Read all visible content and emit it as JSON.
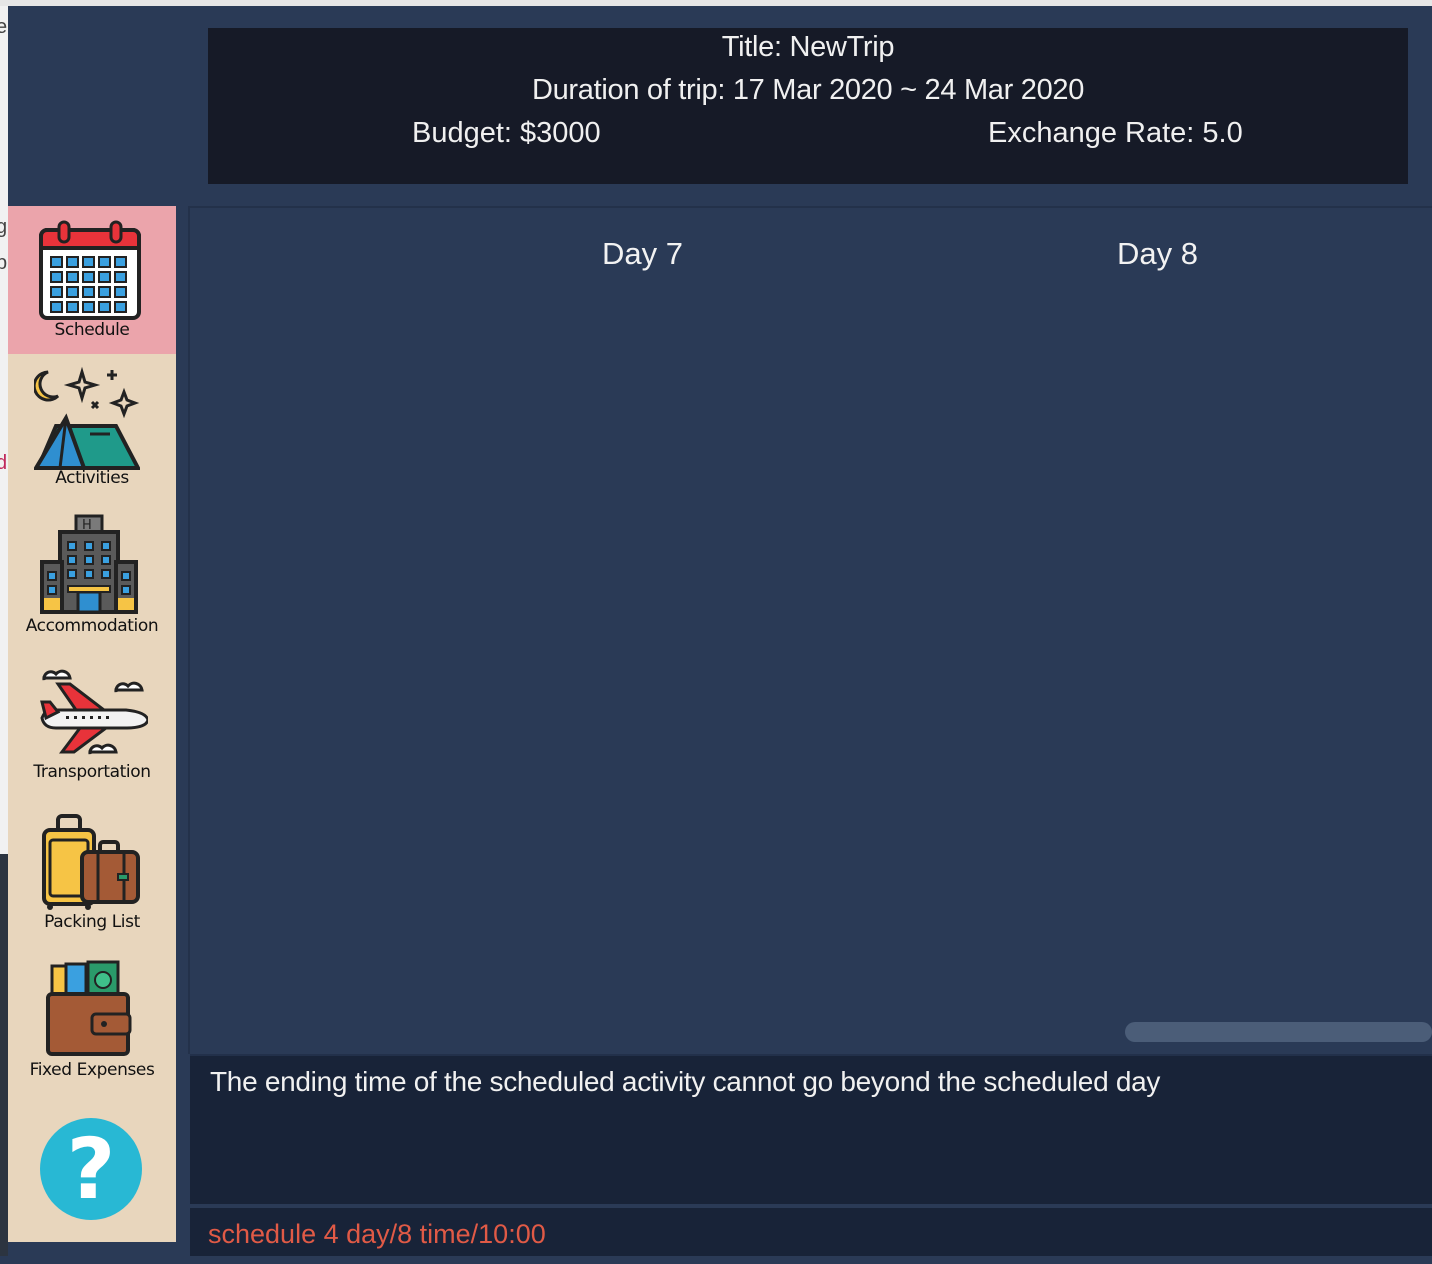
{
  "header": {
    "title": "Title: NewTrip",
    "duration": "Duration of trip: 17 Mar 2020 ~ 24 Mar 2020",
    "budget": "Budget: $3000",
    "exchange_rate": "Exchange Rate: 5.0"
  },
  "sidebar": {
    "items": [
      {
        "label": "Schedule",
        "icon": "calendar-icon",
        "active": true
      },
      {
        "label": "Activities",
        "icon": "tent-icon",
        "active": false
      },
      {
        "label": "Accommodation",
        "icon": "hotel-icon",
        "active": false
      },
      {
        "label": "Transportation",
        "icon": "airplane-icon",
        "active": false
      },
      {
        "label": "Packing List",
        "icon": "luggage-icon",
        "active": false
      },
      {
        "label": "Fixed Expenses",
        "icon": "wallet-icon",
        "active": false
      }
    ],
    "help": {
      "label": "?",
      "icon": "help-icon"
    }
  },
  "schedule": {
    "days": [
      "Day 7",
      "Day 8"
    ]
  },
  "result": {
    "message": "The ending time of the scheduled activity cannot go beyond the scheduled day"
  },
  "command": {
    "value": "schedule 4 day/8 time/10:00"
  },
  "colors": {
    "background": "#2a3a56",
    "header_bg": "#161a27",
    "sidebar_bg": "#e8d6bd",
    "sidebar_active": "#eba4ab",
    "command_text": "#e05a46",
    "help_button": "#28b8d4"
  }
}
